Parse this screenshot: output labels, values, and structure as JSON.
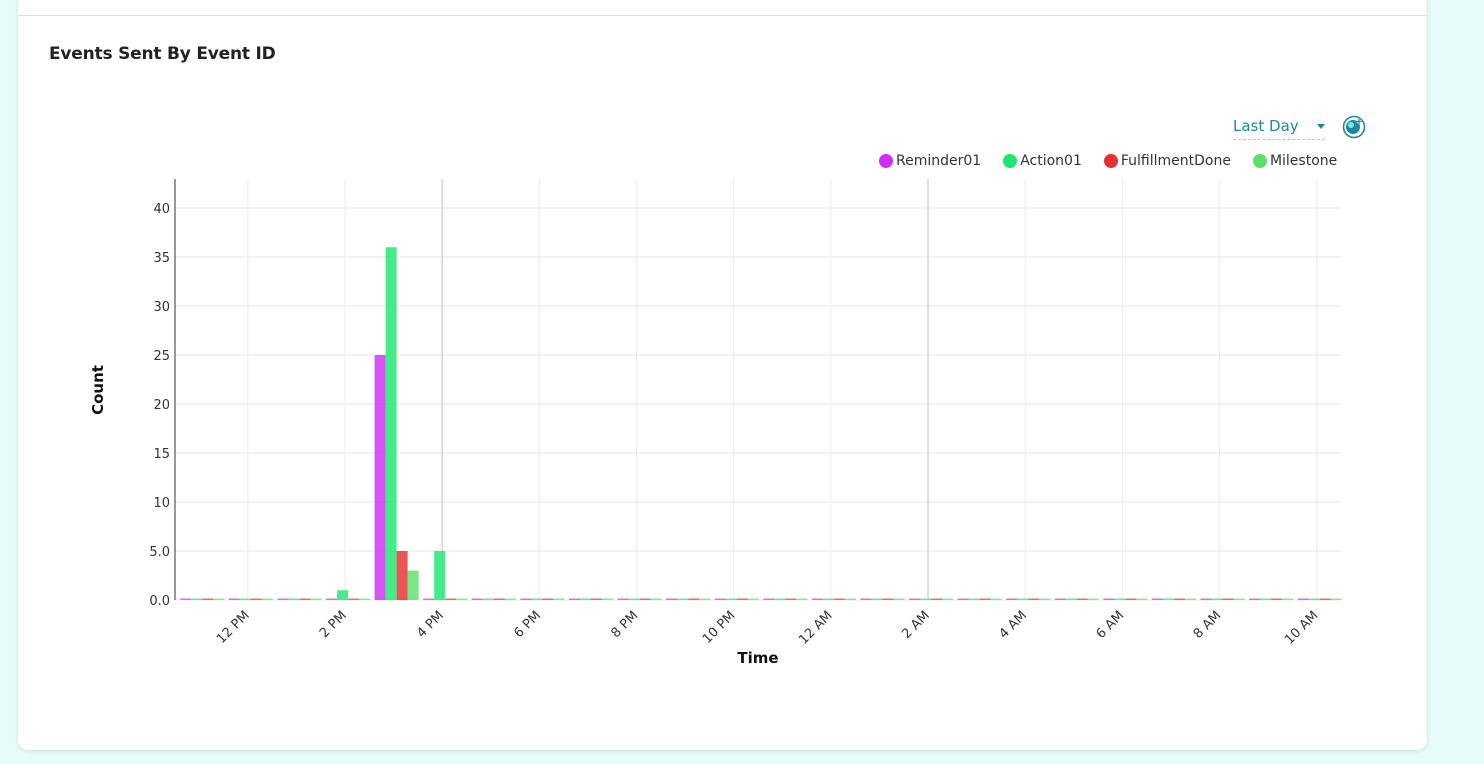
{
  "card": {
    "title": "Events Sent By Event ID"
  },
  "controls": {
    "range_label": "Last Day",
    "refresh_icon": "refresh-icon"
  },
  "colors": {
    "Reminder01": "#d12ef5",
    "Action01": "#1ee870",
    "FulfillmentDone": "#e83030",
    "Milestone": "#5de06b",
    "accent": "#1a8aa0"
  },
  "chart_data": {
    "type": "bar",
    "xlabel": "Time",
    "ylabel": "Count",
    "ylim": [
      0,
      40
    ],
    "yticks": [
      "0.0",
      "5.0",
      "10",
      "15",
      "20",
      "25",
      "30",
      "35",
      "40"
    ],
    "yticks_values": [
      0,
      5,
      10,
      15,
      20,
      25,
      30,
      35,
      40
    ],
    "xtick_labels": [
      "12 PM",
      "2 PM",
      "4 PM",
      "6 PM",
      "8 PM",
      "10 PM",
      "12 AM",
      "2 AM",
      "4 AM",
      "6 AM",
      "8 AM",
      "10 AM"
    ],
    "legend_position": "top-right",
    "grid": true,
    "series": [
      {
        "name": "Reminder01",
        "values": [
          0,
          0,
          0,
          0,
          25,
          0,
          0,
          0,
          0,
          0,
          0,
          0,
          0,
          0,
          0,
          0,
          0,
          0,
          0,
          0,
          0,
          0,
          0,
          0
        ]
      },
      {
        "name": "Action01",
        "values": [
          0,
          0,
          0,
          1,
          36,
          5,
          0,
          0,
          0,
          0,
          0,
          0,
          0,
          0,
          0,
          0,
          0,
          0,
          0,
          0,
          0,
          0,
          0,
          0
        ]
      },
      {
        "name": "FulfillmentDone",
        "values": [
          0,
          0,
          0,
          0,
          5,
          0,
          0,
          0,
          0,
          0,
          0,
          0,
          0,
          0,
          0,
          0,
          0,
          0,
          0,
          0,
          0,
          0,
          0,
          0
        ]
      },
      {
        "name": "Milestone",
        "values": [
          0,
          0,
          0,
          0,
          3,
          0,
          0,
          0,
          0,
          0,
          0,
          0,
          0,
          0,
          0,
          0,
          0,
          0,
          0,
          0,
          0,
          0,
          0,
          0
        ]
      }
    ]
  }
}
